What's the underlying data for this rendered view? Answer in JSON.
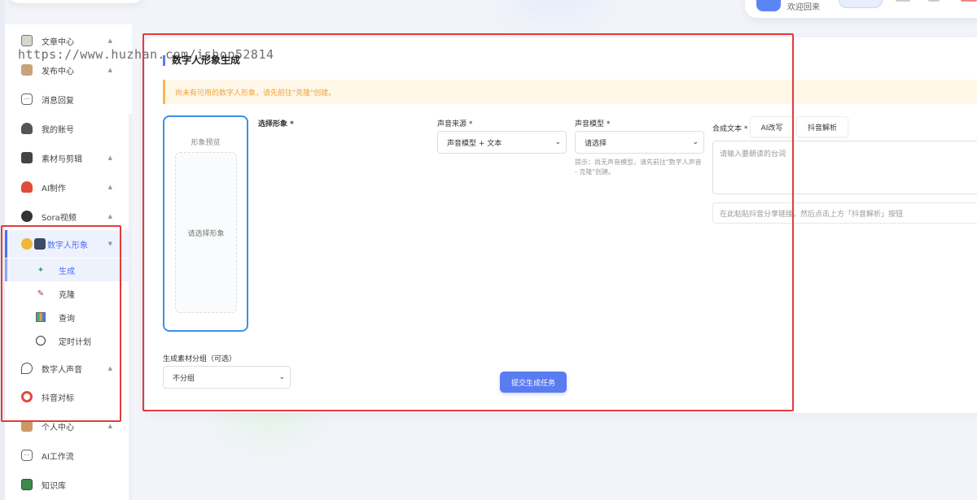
{
  "header": {
    "welcome": "欢迎回来"
  },
  "watermark": "https://www.huzhan.com/ishop52814",
  "sidebar": {
    "items": [
      {
        "label": "文章中心",
        "icon": "notebook-icon",
        "arrow": "▲"
      },
      {
        "label": "发布中心",
        "icon": "box-icon",
        "arrow": "▲"
      },
      {
        "label": "消息回复",
        "icon": "chat-icon",
        "arrow": ""
      },
      {
        "label": "我的账号",
        "icon": "user-icon",
        "arrow": ""
      },
      {
        "label": "素材与剪辑",
        "icon": "film-icon",
        "arrow": "▲"
      },
      {
        "label": "AI制作",
        "icon": "flask-icon",
        "arrow": "▲"
      },
      {
        "label": "Sora视频",
        "icon": "robot-icon",
        "arrow": "▲"
      },
      {
        "label": "数字人形象",
        "icon": "digital-human-icon",
        "arrow": "▼"
      },
      {
        "label": "数字人声音",
        "icon": "voice-icon",
        "arrow": "▲"
      },
      {
        "label": "抖音对标",
        "icon": "target-icon",
        "arrow": ""
      },
      {
        "label": "个人中心",
        "icon": "person-icon",
        "arrow": "▲"
      },
      {
        "label": "AI工作流",
        "icon": "workflow-icon",
        "arrow": ""
      },
      {
        "label": "知识库",
        "icon": "book-icon",
        "arrow": ""
      }
    ],
    "subitems": [
      {
        "label": "生成",
        "icon": "sparkle-icon"
      },
      {
        "label": "克隆",
        "icon": "syringe-icon"
      },
      {
        "label": "查询",
        "icon": "chart-icon"
      },
      {
        "label": "定时计划",
        "icon": "stopwatch-icon"
      }
    ]
  },
  "main": {
    "title": "数字人形象生成",
    "alert": "尚未有可用的数字人形象，请先前往\"克隆\"创建。",
    "preview": {
      "label": "形象预览",
      "placeholder": "请选择形象"
    },
    "select_avatar_label": "选择形象 *",
    "voice_source": {
      "label": "声音来源 *",
      "value": "声音模型 + 文本"
    },
    "voice_model": {
      "label": "声音模型 *",
      "value": "请选择",
      "hint": "提示：尚无声音模型，请先前往\"数字人声音 - 克隆\"创建。"
    },
    "text": {
      "label": "合成文本 *",
      "ai_rewrite": "AI改写",
      "douyin_parse": "抖音解析",
      "placeholder": "请输入要朗读的台词",
      "link_placeholder": "在此粘贴抖音分享链接，然后点击上方「抖音解析」按钮"
    },
    "group": {
      "label": "生成素材分组（可选）",
      "value": "不分组"
    },
    "submit": "提交生成任务"
  },
  "colors": {
    "accent": "#5a7cf0",
    "alert_text": "#f0a43a",
    "highlight_border": "#e23b3b"
  }
}
